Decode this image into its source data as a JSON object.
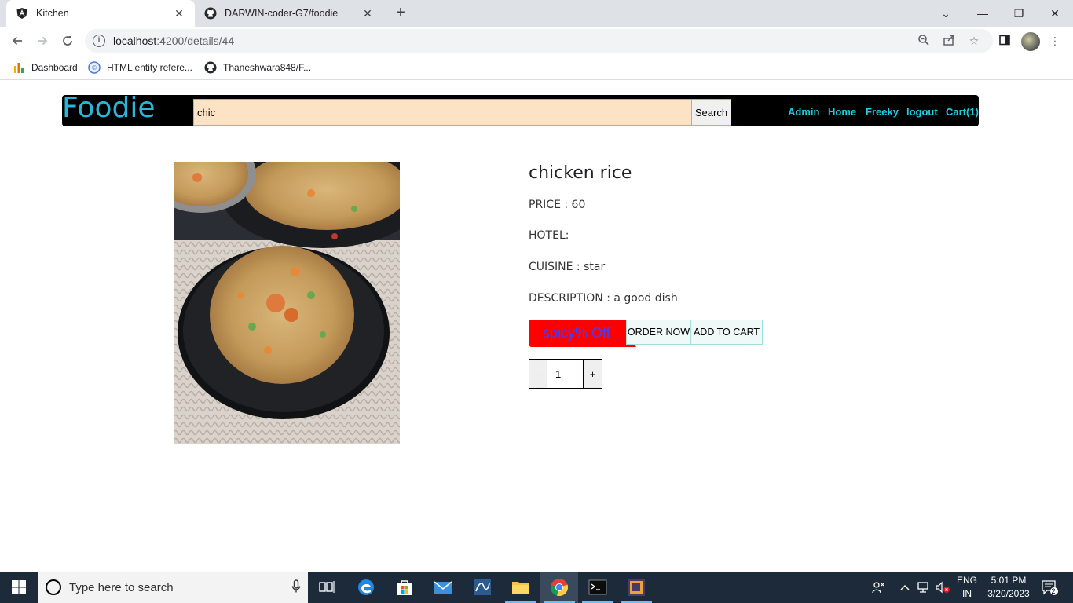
{
  "browser": {
    "tabs": [
      {
        "title": "Kitchen",
        "active": true
      },
      {
        "title": "DARWIN-coder-G7/foodie",
        "active": false
      }
    ],
    "url_host": "localhost",
    "url_path": ":4200/details/44",
    "bookmarks": [
      {
        "label": "Dashboard",
        "icon": "dashboard-icon"
      },
      {
        "label": "HTML entity refere...",
        "icon": "html-entity-icon"
      },
      {
        "label": "Thaneshwara848/F...",
        "icon": "github-icon"
      }
    ]
  },
  "navbar": {
    "brand": "Foodie",
    "search_value": "chic",
    "search_button": "Search",
    "links": [
      "Admin",
      "Home",
      "Freeky",
      "logout",
      "Cart(1)"
    ]
  },
  "product": {
    "name": "chicken rice",
    "price": "PRICE : 60",
    "hotel": "HOTEL:",
    "cuisine": "CUISINE : star",
    "description": "DESCRIPTION : a good dish",
    "discount": "spicy% Off",
    "order_button": "ORDER NOW",
    "cart_button": "ADD TO CART",
    "qty_minus": "-",
    "qty_value": "1",
    "qty_plus": "+"
  },
  "taskbar": {
    "search_placeholder": "Type here to search",
    "lang_line1": "ENG",
    "lang_line2": "IN",
    "time": "5:01 PM",
    "date": "3/20/2023",
    "notifications": "2"
  },
  "colors": {
    "brand": "#29b6d8",
    "nav_link": "#1ecbe1",
    "search_bg": "#fde3c5",
    "discount_bg": "#ff0000",
    "discount_text": "#3f3fff"
  }
}
